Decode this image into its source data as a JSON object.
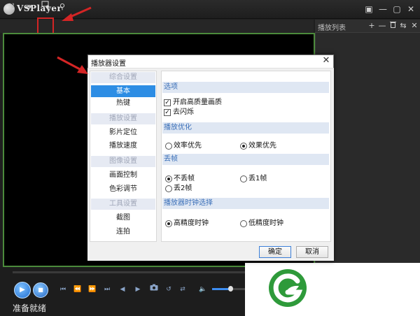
{
  "window": {
    "title": "VSPlayer",
    "buttons": [
      "▣",
      "—",
      "▢",
      "✕"
    ]
  },
  "toolbar": {
    "buttons": [
      "fullscreen-icon",
      "pin-icon",
      "window-snapshot-icon",
      "search-icon"
    ]
  },
  "playlist": {
    "title": "播放列表",
    "buttons": [
      "+",
      "—",
      "🗑",
      "⇆"
    ]
  },
  "status": "准备就绪",
  "volume_level": 0.52,
  "dialog": {
    "title": "播放器设置",
    "close": "✕",
    "nav": [
      {
        "group": "综合设置",
        "items": [
          "基本",
          "热键"
        ]
      },
      {
        "group": "播放设置",
        "items": [
          "影片定位",
          "播放速度"
        ]
      },
      {
        "group": "图像设置",
        "items": [
          "画面控制",
          "色彩调节"
        ]
      },
      {
        "group": "工具设置",
        "items": [
          "截图",
          "连拍"
        ]
      }
    ],
    "selected": "基本",
    "sections": {
      "options": {
        "title": "选项",
        "items": [
          {
            "label": "开启高质量画质",
            "checked": true
          },
          {
            "label": "去闪烁",
            "checked": true
          }
        ]
      },
      "optimization": {
        "title": "播放优化",
        "items": [
          {
            "label": "效率优先",
            "selected": false
          },
          {
            "label": "效果优先",
            "selected": true
          }
        ]
      },
      "frame_drop": {
        "title": "丢帧",
        "items": [
          {
            "label": "不丢帧",
            "selected": true
          },
          {
            "label": "丢1帧",
            "selected": false
          },
          {
            "label": "丢2帧",
            "selected": false
          }
        ]
      },
      "clock": {
        "title": "播放器时钟选择",
        "items": [
          {
            "label": "高精度时钟",
            "selected": true
          },
          {
            "label": "低精度时钟",
            "selected": false
          }
        ]
      }
    },
    "ok": "确定",
    "cancel": "取消"
  },
  "colors": {
    "accent": "#2d8de4",
    "video_border": "#4b8a3b",
    "highlight": "#d42525",
    "logo_green": "#2e9a3a"
  }
}
